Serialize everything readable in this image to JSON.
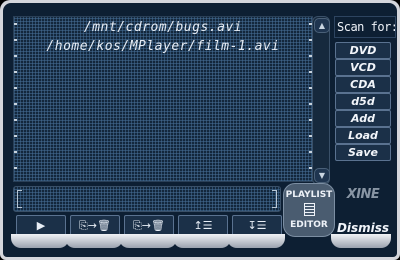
{
  "playlist": {
    "items": [
      "/mnt/cdrom/bugs.avi",
      "/home/kos/MPlayer/film-1.avi"
    ]
  },
  "scan": {
    "label": "Scan for:"
  },
  "right_buttons": {
    "dvd": "DVD",
    "vcd": "VCD",
    "cda": "CDA",
    "d5d": "d5d",
    "add": "Add",
    "load": "Load",
    "save": "Save"
  },
  "brand": {
    "logo_text": "XINE",
    "editor_line1": "PLAYLIST",
    "editor_line2": "EDITOR"
  },
  "bottom_buttons": [
    {
      "name": "play",
      "glyph": "▶"
    },
    {
      "name": "move-up",
      "glyph": "⎘→🗑"
    },
    {
      "name": "move-down",
      "glyph": "⎘→🗑"
    },
    {
      "name": "first",
      "glyph": "↥☰"
    },
    {
      "name": "last",
      "glyph": "↧☰"
    }
  ],
  "dismiss_label": "Dismiss",
  "colors": {
    "panel": "#0d1f33",
    "frame": "#d4d6dc",
    "button": "#1b3048",
    "text": "#eef2f8"
  }
}
